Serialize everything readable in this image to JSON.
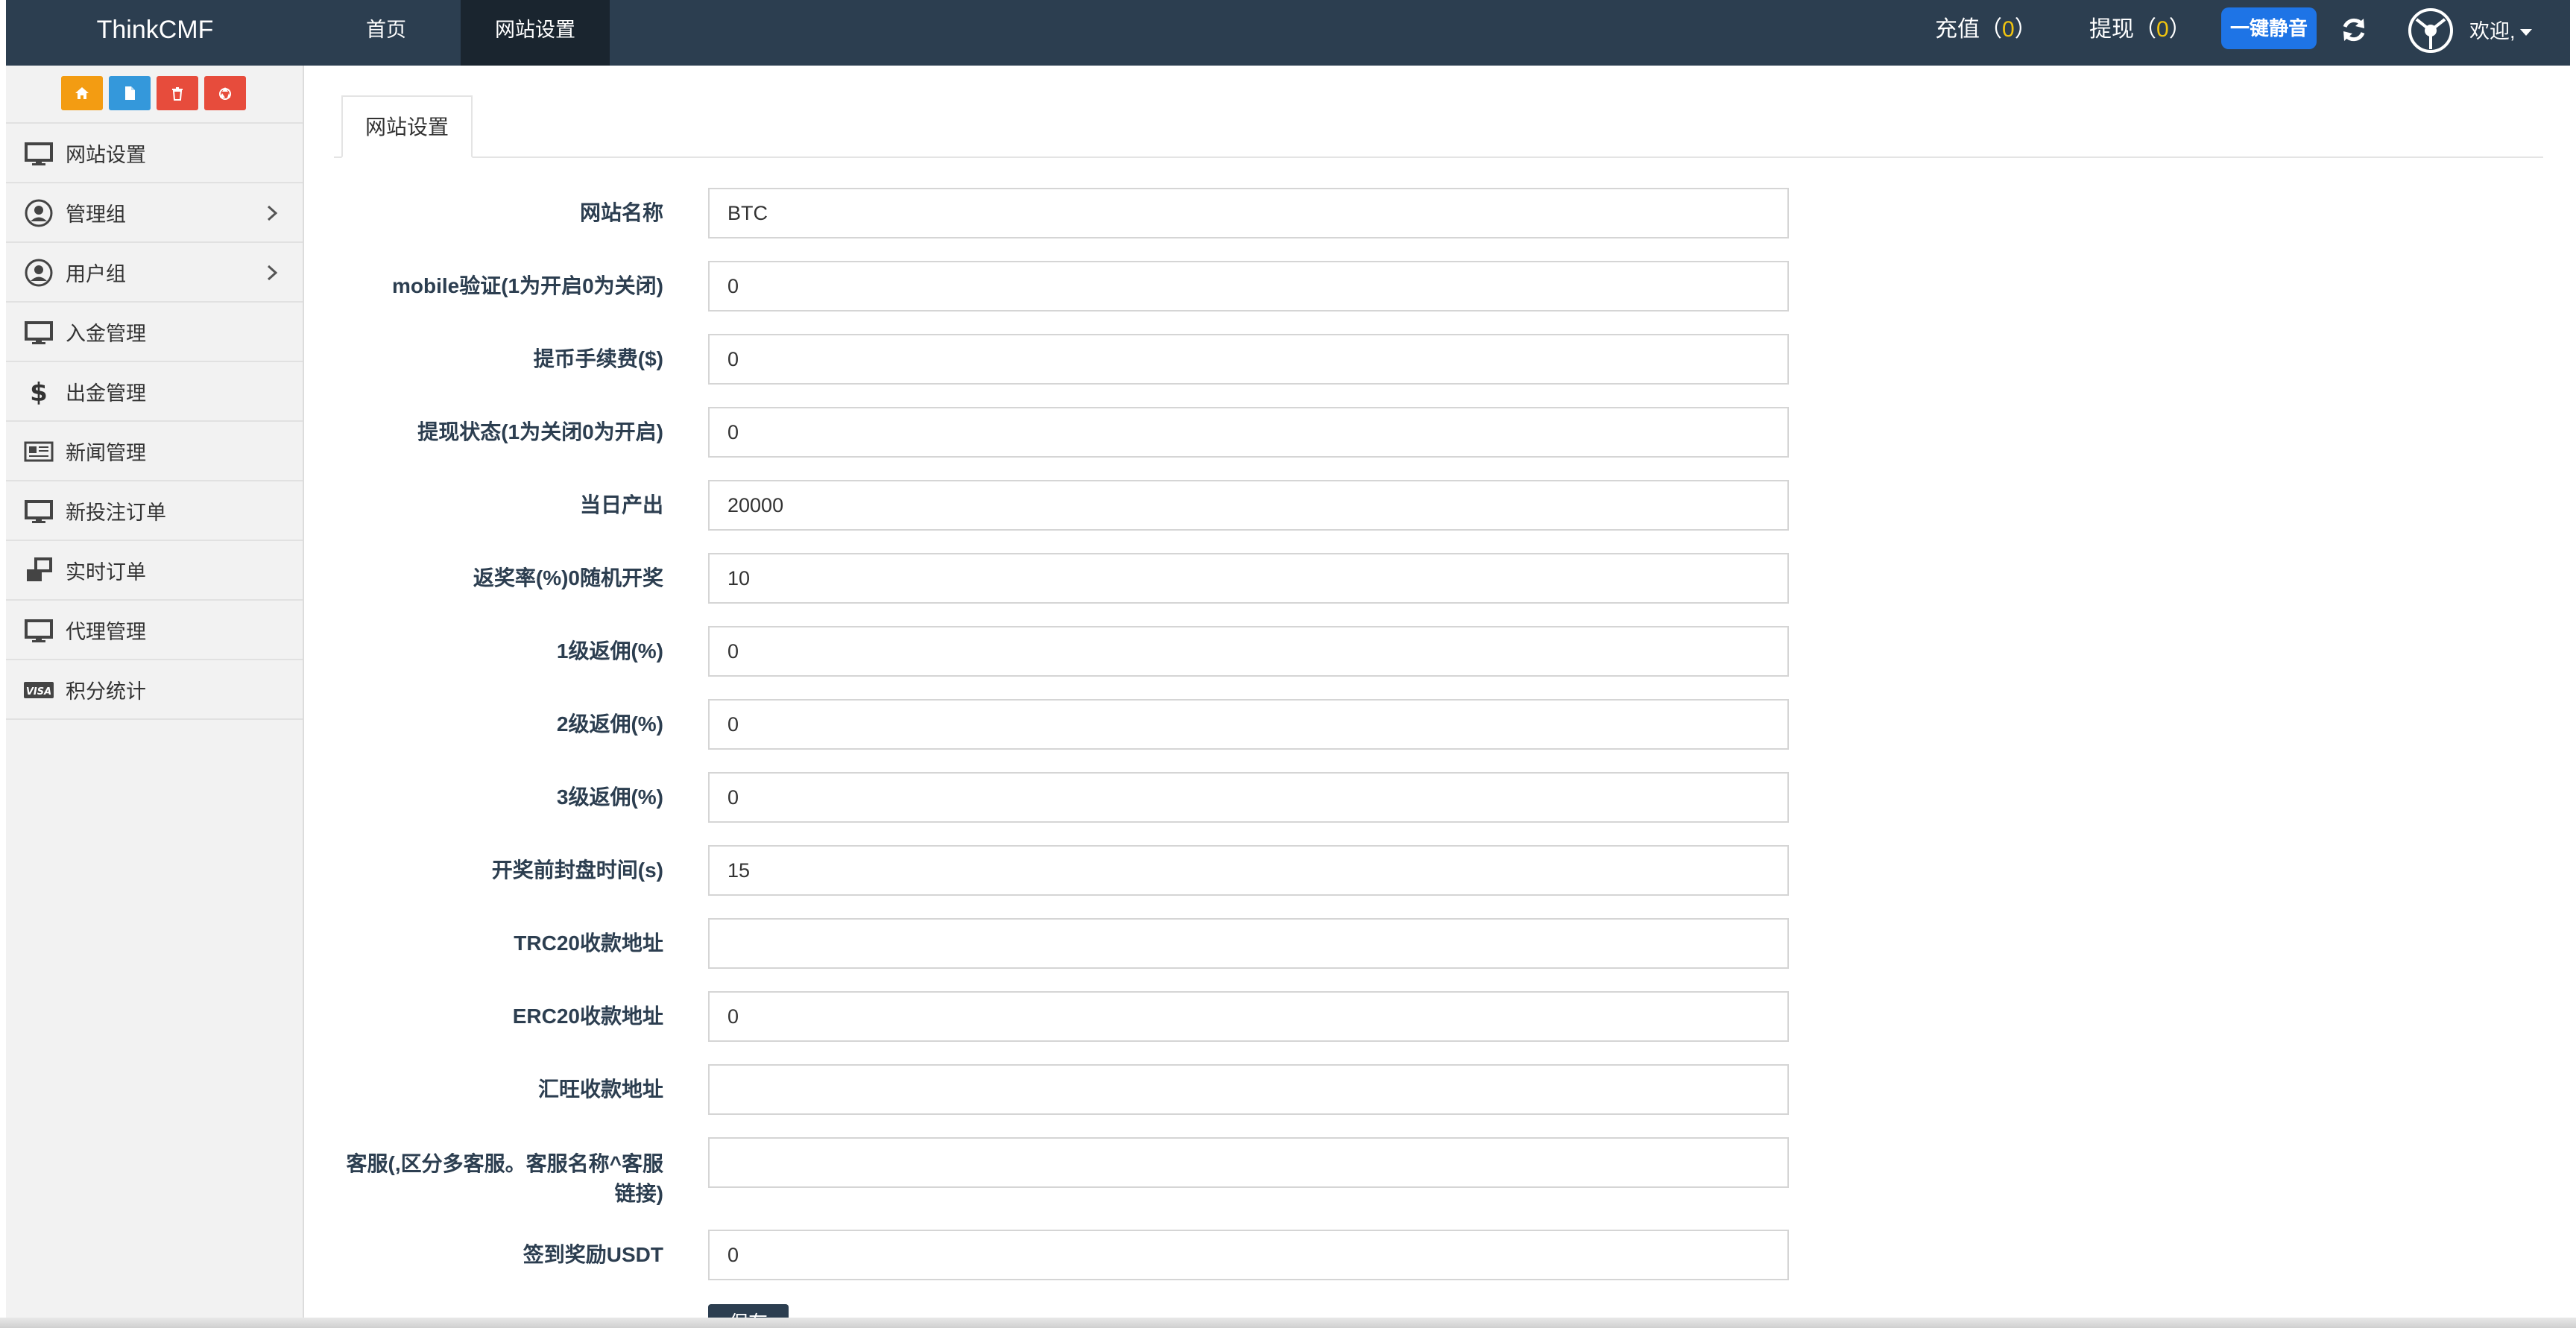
{
  "navbar": {
    "brand": "ThinkCMF",
    "tabs": [
      {
        "label": "首页"
      },
      {
        "label": "网站设置"
      }
    ],
    "recharge_label": "充值（",
    "recharge_count": "0",
    "recharge_suffix": "）",
    "withdraw_label": "提现（",
    "withdraw_count": "0",
    "withdraw_suffix": "）",
    "mute_button": "一键静音",
    "welcome": "欢迎,",
    "icons": [
      "refresh-icon",
      "avatar-icon",
      "caret-down-icon"
    ]
  },
  "sidebar": {
    "shortcuts": [
      {
        "icon": "home-icon",
        "color": "#f39c12"
      },
      {
        "icon": "file-icon",
        "color": "#3498db"
      },
      {
        "icon": "trash-icon",
        "color": "#e74c3c"
      },
      {
        "icon": "recycle-icon",
        "color": "#e74c3c"
      }
    ],
    "items": [
      {
        "label": "网站设置",
        "icon": "desktop-icon"
      },
      {
        "label": "管理组",
        "icon": "user-circle-icon",
        "expandable": true
      },
      {
        "label": "用户组",
        "icon": "user-circle-icon",
        "expandable": true
      },
      {
        "label": "入金管理",
        "icon": "desktop-icon"
      },
      {
        "label": "出金管理",
        "icon": "dollar-icon"
      },
      {
        "label": "新闻管理",
        "icon": "newspaper-icon"
      },
      {
        "label": "新投注订单",
        "icon": "desktop-icon"
      },
      {
        "label": "实时订单",
        "icon": "windows-icon"
      },
      {
        "label": "代理管理",
        "icon": "desktop-icon"
      },
      {
        "label": "积分统计",
        "icon": "visa-icon"
      }
    ]
  },
  "main": {
    "tab": "网站设置",
    "fields": [
      {
        "label": "网站名称",
        "value": "BTC"
      },
      {
        "label": "mobile验证(1为开启0为关闭)",
        "value": "0"
      },
      {
        "label": "提币手续费($)",
        "value": "0"
      },
      {
        "label": "提现状态(1为关闭0为开启)",
        "value": "0"
      },
      {
        "label": "当日产出",
        "value": "20000"
      },
      {
        "label": "返奖率(%)0随机开奖",
        "value": "10"
      },
      {
        "label": "1级返佣(%)",
        "value": "0"
      },
      {
        "label": "2级返佣(%)",
        "value": "0"
      },
      {
        "label": "3级返佣(%)",
        "value": "0"
      },
      {
        "label": "开奖前封盘时间(s)",
        "value": "15"
      },
      {
        "label": "TRC20收款地址",
        "value": ""
      },
      {
        "label": "ERC20收款地址",
        "value": "0"
      },
      {
        "label": "汇旺收款地址",
        "value": ""
      },
      {
        "label": "客服(,区分多客服。客服名称^客服链接)",
        "value": ""
      },
      {
        "label": "签到奖励USDT",
        "value": "0"
      }
    ],
    "save_button": "保存"
  },
  "colors": {
    "navbar": "#2c3e50",
    "accent_blue": "#1e74e6",
    "count_yellow": "#f1c40f"
  }
}
